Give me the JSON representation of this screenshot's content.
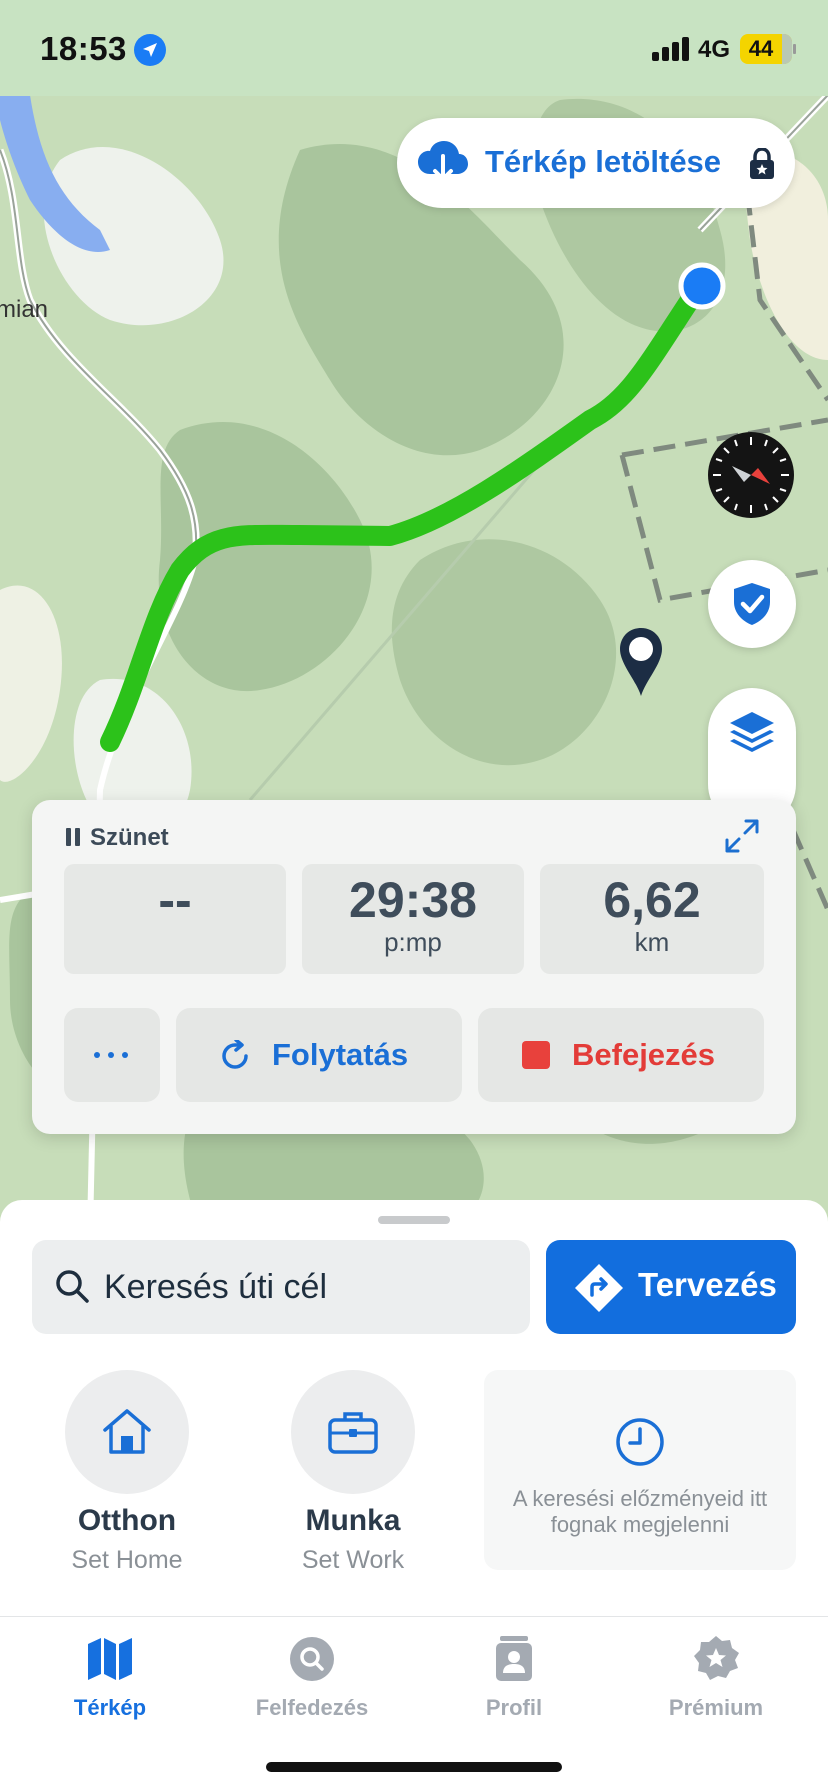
{
  "status_bar": {
    "time": "18:53",
    "network": "4G",
    "battery": "44",
    "location_icon": "location-arrow-icon"
  },
  "map": {
    "download_label": "Térkép letöltése",
    "place_label": "mian",
    "route_color": "#2cc21a",
    "position_color": "#1a7cf5"
  },
  "tracking": {
    "status": "Szünet",
    "stats": [
      {
        "value": "--",
        "unit": ""
      },
      {
        "value": "29:38",
        "unit": "p:mp"
      },
      {
        "value": "6,62",
        "unit": "km"
      }
    ],
    "more_label": "...",
    "resume_label": "Folytatás",
    "finish_label": "Befejezés",
    "finish_color": "#e8413c"
  },
  "sheet": {
    "search_placeholder": "Keresés úti cél",
    "plan_label": "Tervezés",
    "shortcuts": [
      {
        "title": "Otthon",
        "subtitle": "Set Home",
        "icon": "home-icon"
      },
      {
        "title": "Munka",
        "subtitle": "Set Work",
        "icon": "briefcase-icon"
      }
    ],
    "history_text": "A keresési előzményeid itt fognak megjelenni"
  },
  "tabbar": {
    "tabs": [
      {
        "label": "Térkép",
        "icon": "map-icon",
        "active": true
      },
      {
        "label": "Felfedezés",
        "icon": "explore-icon",
        "active": false
      },
      {
        "label": "Profil",
        "icon": "profile-icon",
        "active": false
      },
      {
        "label": "Prémium",
        "icon": "premium-star-icon",
        "active": false
      }
    ]
  },
  "colors": {
    "accent": "#1670df",
    "map_bg": "#c6dcb9"
  }
}
